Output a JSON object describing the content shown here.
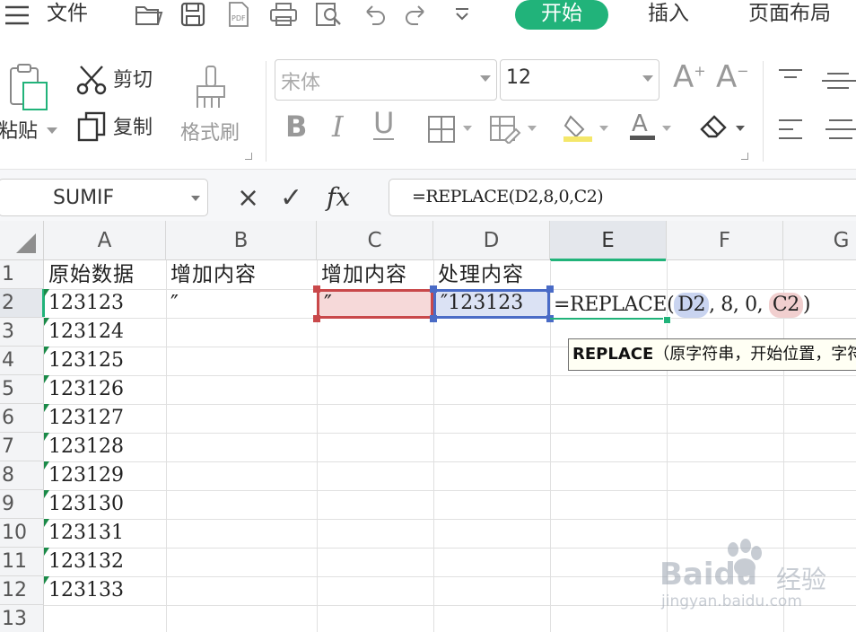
{
  "menubar": {
    "items": [
      "文件",
      "插入",
      "页面布局"
    ],
    "active_tab": "开始"
  },
  "ribbon": {
    "clipboard": {
      "paste": "粘贴",
      "cut": "剪切",
      "copy": "复制",
      "format_painter": "格式刷"
    },
    "font": {
      "name": "宋体",
      "size": "12"
    },
    "format_glyphs": {
      "bold": "B",
      "italic": "I",
      "underline": "U",
      "grow": "A",
      "shrink": "A"
    }
  },
  "formula_bar": {
    "name_box": "SUMIF",
    "cancel_glyph": "×",
    "confirm_glyph": "✓",
    "fx_glyph": "fx",
    "formula": "=REPLACE(D2,8,0,C2)"
  },
  "sheet": {
    "columns": [
      "A",
      "B",
      "C",
      "D",
      "E",
      "F",
      "G"
    ],
    "active_column": "E",
    "rows": [
      "1",
      "2",
      "3",
      "4",
      "5",
      "6",
      "7",
      "8",
      "9",
      "10",
      "11",
      "12",
      "13"
    ],
    "active_row": "2",
    "headers": {
      "A1": "原始数据",
      "B1": "增加内容",
      "C1": "增加内容",
      "D1": "处理内容"
    },
    "col_a_values": [
      "123123",
      "123124",
      "123125",
      "123126",
      "123127",
      "123128",
      "123129",
      "123130",
      "123131",
      "123132",
      "123133"
    ],
    "B2": "″",
    "C2": "″",
    "D2": "″123123",
    "E2_formula": {
      "prefix": "=REPLACE",
      "open": "(",
      "ref1": "D2",
      "middle": ", 8, 0, ",
      "ref2": "C2",
      "close": ")"
    }
  },
  "tooltip": {
    "func": "REPLACE",
    "args": "（原字符串，开始位置，字符个数，新字符串）"
  },
  "watermark": {
    "brand": "Baidu",
    "subtitle": "经验",
    "url": "jingyan.baidu.com"
  },
  "colors": {
    "accent": "#21b37a",
    "ref_red": "#c9484a",
    "ref_red_fill": "#f6d9d9",
    "ref_blue": "#4a6bc6",
    "ref_blue_fill": "#dbe2f4"
  }
}
